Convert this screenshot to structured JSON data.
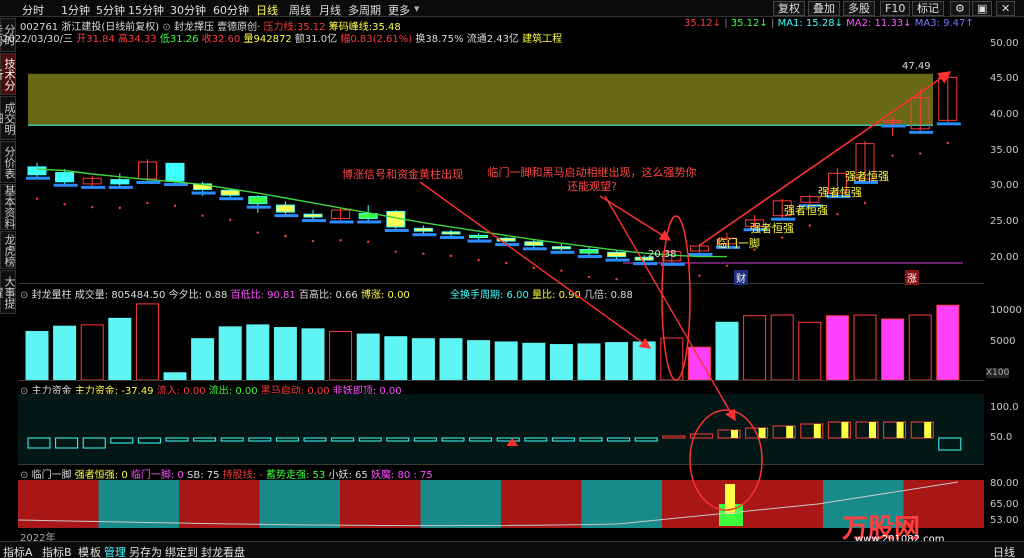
{
  "toolbar": {
    "periods": [
      "分时",
      "1分钟",
      "5分钟",
      "15分钟",
      "30分钟",
      "60分钟",
      "日线",
      "周线",
      "月线",
      "多周期",
      "更多"
    ],
    "selected": "日线",
    "right": [
      "复权",
      "叠加",
      "多股",
      "F10",
      "标记"
    ]
  },
  "side_tabs": [
    "分时走势",
    "技术分析",
    "成交明细",
    "分价表",
    "基本资料",
    "龙虎榜",
    "大事提醒"
  ],
  "main": {
    "code": "002761",
    "name": "浙江建投(日线前复权)",
    "indicator": "封龙擇压",
    "indicator2": "壹德原创·",
    "pressure_label": "压力线:",
    "pressure_value": "35.12",
    "chips_label": "筹码峰线:",
    "chips_value": "35.48",
    "right_val1": "35.12",
    "right_val2": "35.12",
    "ma1": "MA1: 15.28",
    "ma2": "MA2: 11.33",
    "ma3": "MA3: 9.47",
    "date": "2022/03/30/三",
    "open": "开31.84",
    "high": "高34.33",
    "low": "低31.26",
    "close": "收32.60",
    "vol": "量942872",
    "amount": "额31.0亿",
    "change": "幅0.83(2.61%)",
    "turnover": "换38.75%",
    "float": "流通2.43亿",
    "industry": "建筑工程",
    "peak_label": "47.49",
    "low_label": "20.38",
    "cai": "财",
    "zhang": "涨",
    "yticks": [
      "50.00",
      "45.00",
      "40.00",
      "35.00",
      "30.00",
      "25.00",
      "20.00"
    ],
    "annotations": {
      "a1": "博涨信号和资金黄柱出现",
      "a2": "临门一脚和黑马启动相继出现，这么强势你还能观望?",
      "qiang": "强者恒强",
      "linmen": "临门一脚"
    }
  },
  "vol_panel": {
    "title": "封龙量柱",
    "vol": "成交量: 805484.50",
    "jb": "今夕比: 0.88",
    "bd": "百低比: 90.81",
    "bg": "百高比: 0.66",
    "bz": "博涨: 0.00",
    "hs": "全换手周期: 6.00",
    "lb": "量比: 0.90",
    "jbei": "几倍: 0.88",
    "yticks": [
      "10000",
      "5000"
    ],
    "unit": "X100"
  },
  "fund_panel": {
    "title": "主力资金",
    "zl": "主力资金: -37.49",
    "lr": "流入: 0.00",
    "lc": "流出: 0.00",
    "hm": "黑马启动: 0.00",
    "fy": "非妖即顶: 0.00",
    "yticks": [
      "100.0",
      "50.0"
    ]
  },
  "lm_panel": {
    "title": "临门一脚",
    "qz": "强者恒强: 0",
    "lm": "临门一脚: 0",
    "sb": "SB: 75",
    "cg": "持股线: -",
    "xs": "蓄势走强: 53",
    "xy": "小妖: 65",
    "ym": "妖魔: 80",
    "ymv": ": 75",
    "yticks": [
      "80.00",
      "65.00",
      "53.00"
    ],
    "year": "2022年"
  },
  "bottom": [
    "指标A",
    "指标B",
    "模",
    "板",
    "管理",
    "另存为",
    "绑定到",
    "封龙看盘"
  ],
  "bottom_right": "日线",
  "watermark": "万股网",
  "watermark_url": "www.201082.com",
  "chart_data": {
    "type": "candlestick",
    "ylim": [
      18,
      52
    ],
    "candles": [
      {
        "o": 34.3,
        "c": 33.2,
        "h": 34.9,
        "l": 32.6
      },
      {
        "o": 33.5,
        "c": 32.2,
        "h": 34.0,
        "l": 31.8
      },
      {
        "o": 31.9,
        "c": 32.7,
        "h": 33.0,
        "l": 31.4
      },
      {
        "o": 32.5,
        "c": 31.9,
        "h": 33.4,
        "l": 31.3
      },
      {
        "o": 32.6,
        "c": 35.0,
        "h": 35.4,
        "l": 32.0
      },
      {
        "o": 34.8,
        "c": 32.3,
        "h": 34.8,
        "l": 31.6
      },
      {
        "o": 31.9,
        "c": 31.1,
        "h": 32.2,
        "l": 30.2
      },
      {
        "o": 31.0,
        "c": 30.3,
        "h": 31.2,
        "l": 29.6
      },
      {
        "o": 30.1,
        "c": 29.1,
        "h": 30.3,
        "l": 27.8
      },
      {
        "o": 28.9,
        "c": 27.9,
        "h": 29.4,
        "l": 27.3
      },
      {
        "o": 27.6,
        "c": 27.2,
        "h": 28.2,
        "l": 26.6
      },
      {
        "o": 27.0,
        "c": 28.2,
        "h": 28.4,
        "l": 26.7
      },
      {
        "o": 27.7,
        "c": 27.0,
        "h": 28.9,
        "l": 26.5
      },
      {
        "o": 28.0,
        "c": 25.8,
        "h": 28.2,
        "l": 25.1
      },
      {
        "o": 25.6,
        "c": 25.2,
        "h": 26.0,
        "l": 24.8
      },
      {
        "o": 25.1,
        "c": 24.8,
        "h": 25.4,
        "l": 24.5
      },
      {
        "o": 24.6,
        "c": 24.3,
        "h": 24.9,
        "l": 23.9
      },
      {
        "o": 24.2,
        "c": 23.8,
        "h": 24.4,
        "l": 23.5
      },
      {
        "o": 23.7,
        "c": 23.2,
        "h": 24.0,
        "l": 22.8
      },
      {
        "o": 23.0,
        "c": 22.7,
        "h": 23.4,
        "l": 22.4
      },
      {
        "o": 22.6,
        "c": 22.1,
        "h": 22.9,
        "l": 21.5
      },
      {
        "o": 22.2,
        "c": 21.6,
        "h": 22.5,
        "l": 21.2
      },
      {
        "o": 21.5,
        "c": 21.1,
        "h": 21.8,
        "l": 20.7
      },
      {
        "o": 21.0,
        "c": 22.3,
        "h": 22.6,
        "l": 20.4
      },
      {
        "o": 22.4,
        "c": 23.1,
        "h": 23.4,
        "l": 21.7
      },
      {
        "o": 23.4,
        "c": 24.2,
        "h": 25.0,
        "l": 23.1
      },
      {
        "o": 25.9,
        "c": 26.8,
        "h": 27.5,
        "l": 25.4
      },
      {
        "o": 27.4,
        "c": 29.5,
        "h": 29.8,
        "l": 27.1
      },
      {
        "o": 29.3,
        "c": 30.1,
        "h": 30.4,
        "l": 28.8
      },
      {
        "o": 30.6,
        "c": 33.4,
        "h": 34.2,
        "l": 30.4
      },
      {
        "o": 32.6,
        "c": 37.6,
        "h": 38.0,
        "l": 32.0
      },
      {
        "o": 40.6,
        "c": 40.9,
        "h": 41.5,
        "l": 38.7
      },
      {
        "o": 39.7,
        "c": 44.1,
        "h": 45.4,
        "l": 39.0
      },
      {
        "o": 40.9,
        "c": 47.0,
        "h": 47.5,
        "l": 40.5
      }
    ],
    "volume": [
      7400,
      8200,
      8400,
      9400,
      11600,
      1100,
      6300,
      8100,
      8400,
      8000,
      7800,
      7400,
      7000,
      6600,
      6300,
      6300,
      6000,
      5800,
      5600,
      5400,
      5500,
      5700,
      5800,
      6400,
      5000,
      8800,
      9800,
      9900,
      8800,
      9800,
      9900,
      9300,
      9900,
      11400
    ],
    "fund": [
      -1,
      -1,
      -1,
      -0.5,
      -0.5,
      -0.3,
      -0.3,
      -0.3,
      -0.3,
      -0.3,
      -0.3,
      -0.3,
      -0.3,
      -0.3,
      -0.3,
      -0.3,
      -0.3,
      -0.3,
      -0.3,
      -0.3,
      -0.3,
      -0.3,
      -0.3,
      0.2,
      0.4,
      0.8,
      1.0,
      1.2,
      1.4,
      1.6,
      1.6,
      1.6,
      1.6,
      -1.2
    ],
    "lm_zones": [
      "red",
      "teal",
      "red",
      "teal",
      "red",
      "teal",
      "red",
      "teal",
      "red",
      "red",
      "teal",
      "red"
    ]
  }
}
